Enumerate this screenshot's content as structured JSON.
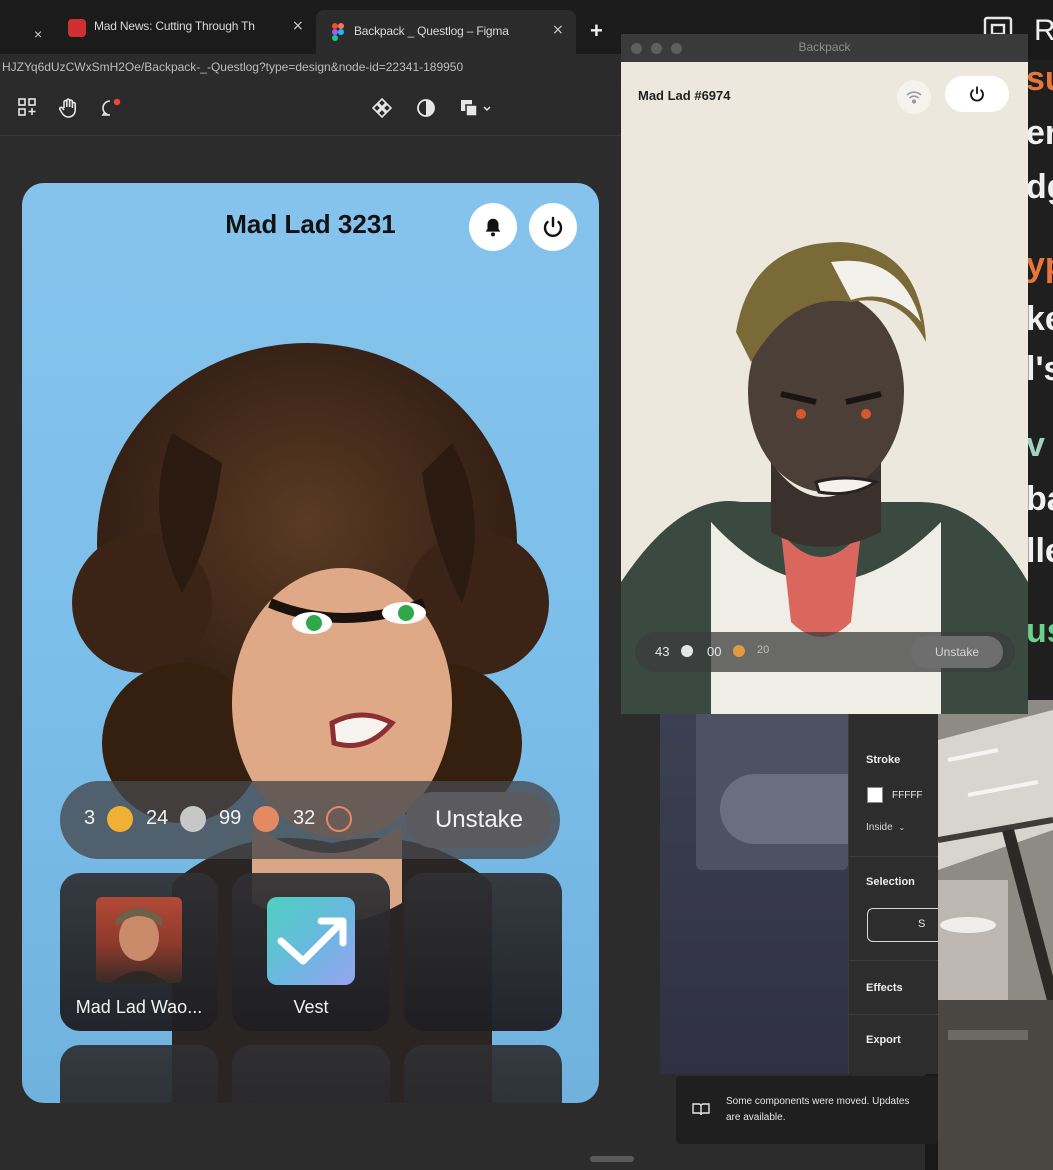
{
  "browser": {
    "tabs": [
      {
        "label": "Mad News: Cutting Through Th",
        "close": "×"
      },
      {
        "label": "Backpack _ Questlog – Figma",
        "close": "×"
      }
    ],
    "first_tab_close": "×",
    "new_tab": "+",
    "url": "HJZYq6dUzCWxSmH2Oe/Backpack-_-Questlog?type=design&node-id=22341-189950"
  },
  "phone": {
    "title": "Mad Lad 3231",
    "stats": [
      {
        "value": "3",
        "color": "#f0b135"
      },
      {
        "value": "24",
        "color": "#c7c7c7"
      },
      {
        "value": "99",
        "color": "#e48a62"
      },
      {
        "value": "32",
        "color": "outline"
      }
    ],
    "unstake_label": "Unstake",
    "tiles": [
      {
        "label": "Mad Lad Wao..."
      },
      {
        "label": "Vest"
      }
    ]
  },
  "window": {
    "title": "Backpack",
    "name": "Mad Lad #6974",
    "stats": [
      {
        "value": "43",
        "color": "#e6e6e6"
      },
      {
        "value": "00",
        "color": "#e39a42"
      },
      {
        "value": "20",
        "color": "#8a5a3a"
      }
    ],
    "unstake_label": "Unstake"
  },
  "right_text": {
    "lines": [
      {
        "text": "R"
      },
      {
        "text": "su",
        "color": "#e8763b"
      },
      {
        "text": "er",
        "color": "#f0f0f0"
      },
      {
        "text": "dg",
        "color": "#f0f0f0"
      },
      {
        "text": "yp",
        "color": "#e8763b"
      },
      {
        "text": "ke",
        "color": "#f0f0f0"
      },
      {
        "text": "l's",
        "color": "#f0f0f0"
      },
      {
        "text": "v",
        "color": "#9fd3c0"
      },
      {
        "text": "ba",
        "color": "#f0f0f0"
      },
      {
        "text": "lle",
        "color": "#f0f0f0"
      },
      {
        "text": "us",
        "color": "#6fcf8a"
      }
    ]
  },
  "properties": {
    "stroke_label": "Stroke",
    "stroke_value": "FFFFF",
    "stroke_position": "Inside",
    "selection_label": "Selection",
    "selection_button": "S",
    "effects_label": "Effects",
    "export_label": "Export"
  },
  "toast": {
    "message": "Some components were moved. Updates are available."
  }
}
